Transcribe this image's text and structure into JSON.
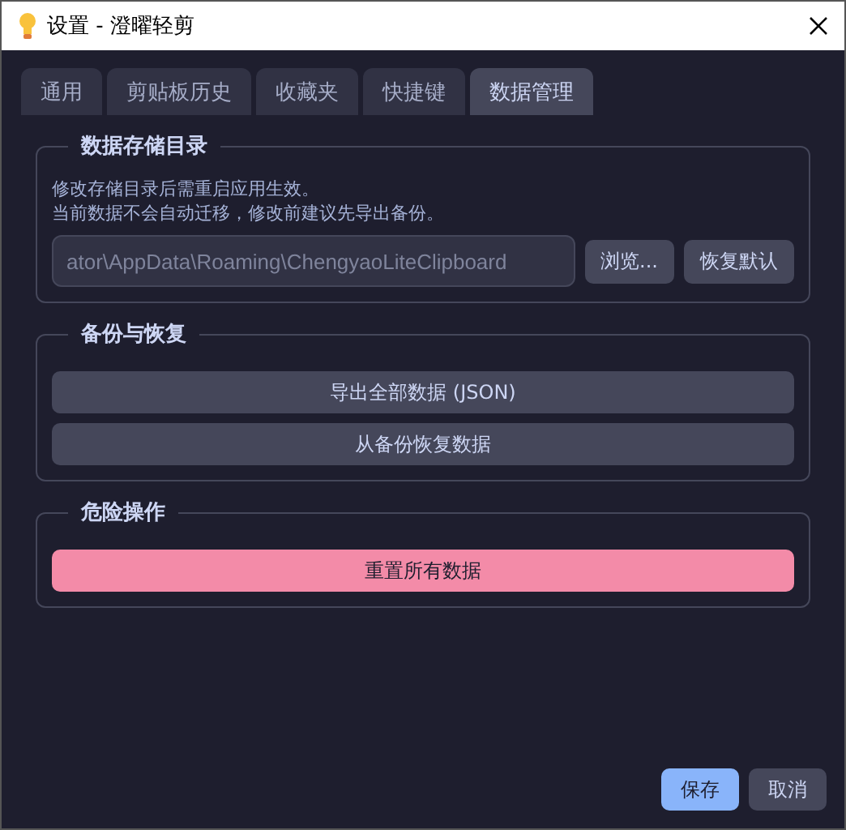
{
  "window": {
    "title": "设置 - 澄曜轻剪"
  },
  "tabs": [
    {
      "label": "通用",
      "selected": false
    },
    {
      "label": "剪贴板历史",
      "selected": false
    },
    {
      "label": "收藏夹",
      "selected": false
    },
    {
      "label": "快捷键",
      "selected": false
    },
    {
      "label": "数据管理",
      "selected": true
    }
  ],
  "sections": [
    {
      "kind": "directory",
      "title": "数据存储目录",
      "description": [
        "修改存储目录后需重启应用生效。",
        "当前数据不会自动迁移，修改前建议先导出备份。"
      ],
      "path_field": {
        "value": "ator\\AppData\\Roaming\\ChengyaoLiteClipboard"
      },
      "buttons": [
        "浏览...",
        "恢复默认"
      ]
    },
    {
      "kind": "actions",
      "title": "备份与恢复",
      "buttons": [
        "导出全部数据 (JSON)",
        "从备份恢复数据"
      ]
    },
    {
      "kind": "danger",
      "title": "危险操作",
      "buttons": [
        "重置所有数据"
      ]
    }
  ],
  "footer_buttons": [
    {
      "label": "保存",
      "kind": "primary"
    },
    {
      "label": "取消",
      "kind": "secondary"
    }
  ]
}
